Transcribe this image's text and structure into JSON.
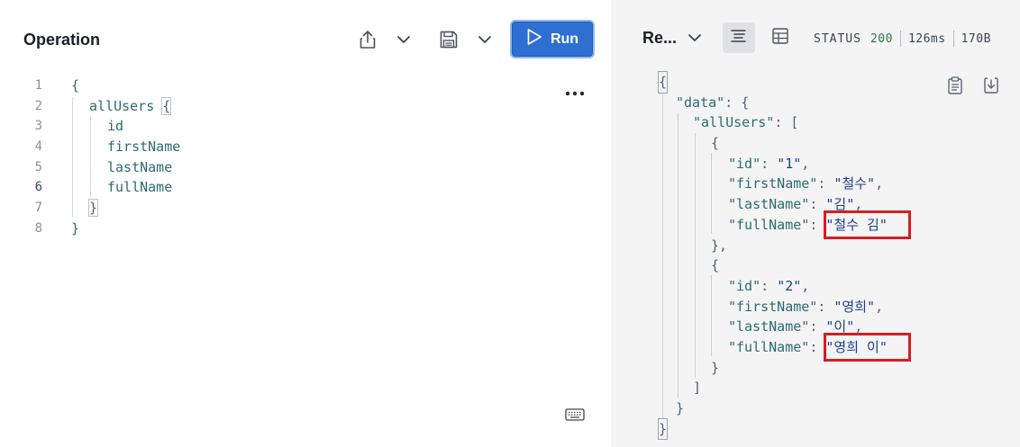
{
  "operation": {
    "title": "Operation",
    "run_label": "Run",
    "icons": {
      "share": "share-icon",
      "share_menu": "chevron-down-icon",
      "save": "save-icon",
      "save_menu": "chevron-down-icon",
      "run": "play-icon",
      "more": "more-horizontal-icon",
      "keyboard": "keyboard-icon"
    },
    "code_lines": [
      {
        "num": "1",
        "text": "{"
      },
      {
        "num": "2",
        "text": "allUsers"
      },
      {
        "num": "3",
        "text": "id"
      },
      {
        "num": "4",
        "text": "firstName"
      },
      {
        "num": "5",
        "text": "lastName"
      },
      {
        "num": "6",
        "text": "fullName"
      },
      {
        "num": "7",
        "text": "}"
      },
      {
        "num": "8",
        "text": "}"
      }
    ],
    "open_brace": "{",
    "active_line": "6"
  },
  "response": {
    "tab_label": "Re...",
    "status_label": "STATUS",
    "status_code": "200",
    "time": "126ms",
    "size": "170B",
    "icons": {
      "tab_menu": "chevron-down-icon",
      "text_view": "text-lines-icon",
      "table_view": "table-icon",
      "copy": "clipboard-icon",
      "download": "download-icon"
    },
    "json": {
      "open": "{",
      "data_key": "\"data\"",
      "all_users_key": "\"allUsers\"",
      "users": [
        {
          "id_key": "\"id\"",
          "id": "\"1\"",
          "first_key": "\"firstName\"",
          "first": "\"철수\"",
          "last_key": "\"lastName\"",
          "last": "\"김\"",
          "full_key": "\"fullName\"",
          "full": "\"철수 김\""
        },
        {
          "id_key": "\"id\"",
          "id": "\"2\"",
          "first_key": "\"firstName\"",
          "first": "\"영희\"",
          "last_key": "\"lastName\"",
          "last": "\"이\"",
          "full_key": "\"fullName\"",
          "full": "\"영희 이\""
        }
      ],
      "highlight_color": "#d41f1f"
    }
  },
  "colors": {
    "run_button": "#2f6fd1",
    "status_ok": "#2d7a4a",
    "key_color": "#2c6b6f",
    "string_color": "#1c3f8f",
    "response_bg": "#f4f4f5"
  }
}
